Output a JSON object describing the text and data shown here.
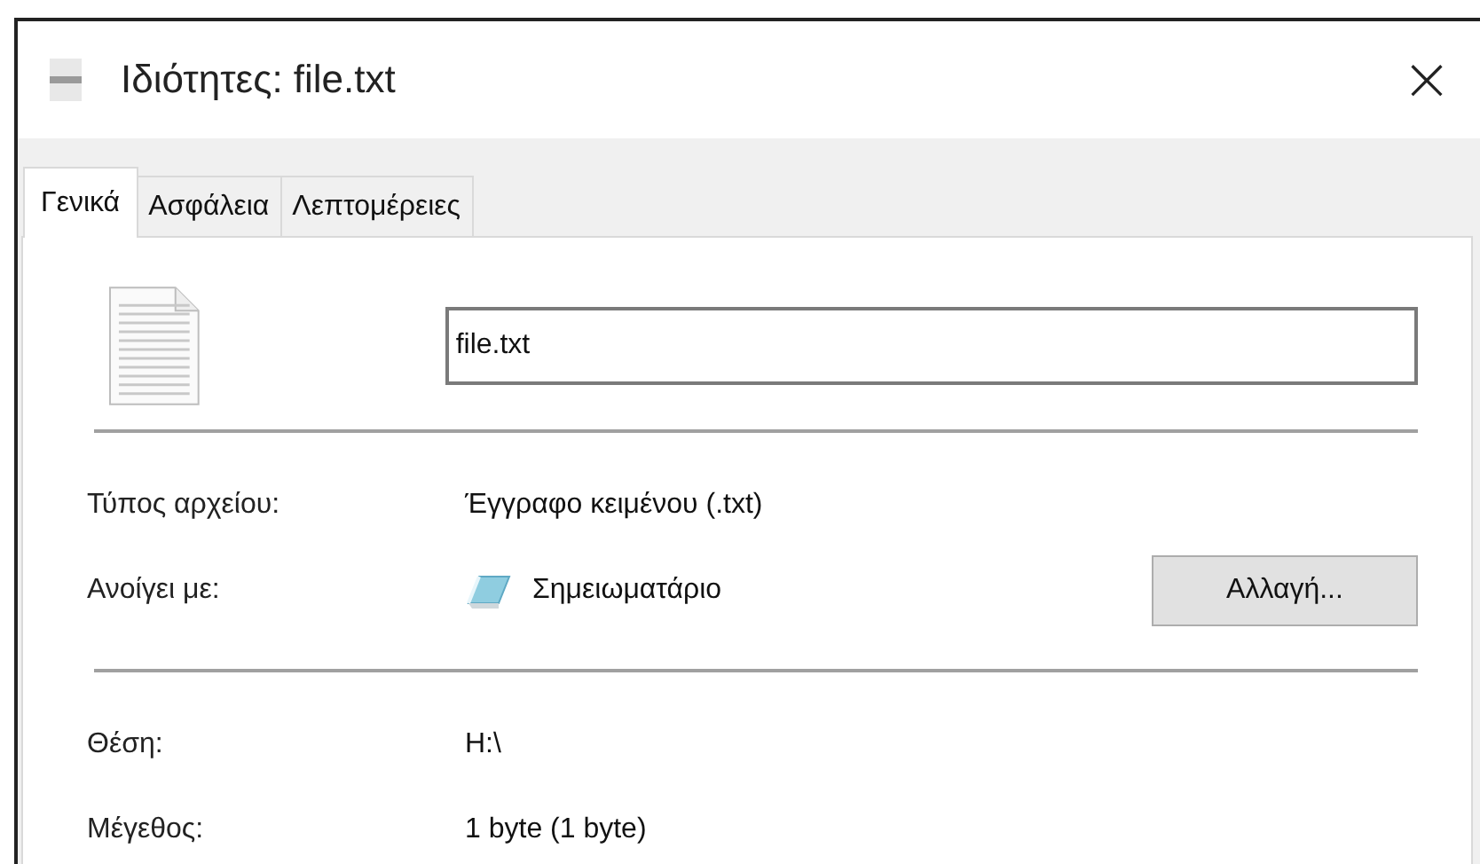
{
  "window": {
    "title": "Ιδιότητες: file.txt",
    "close": "×"
  },
  "tabs": [
    {
      "label": "Γενικά",
      "selected": true
    },
    {
      "label": "Ασφάλεια",
      "selected": false
    },
    {
      "label": "Λεπτομέρειες",
      "selected": false
    }
  ],
  "file_name": {
    "value": "file.txt"
  },
  "groups": [
    [
      {
        "label": "Τύπος αρχείου:",
        "value": "Έγγραφο κειμένου (.txt)"
      },
      {
        "label": "Ανοίγει με:",
        "value": "Σημειωματάριο",
        "kind": "app",
        "button": "Αλλαγή..."
      }
    ],
    [
      {
        "label": "Θέση:",
        "value": "H:\\"
      },
      {
        "label": "Μέγεθος:",
        "value": "1 byte (1 byte)"
      }
    ]
  ]
}
